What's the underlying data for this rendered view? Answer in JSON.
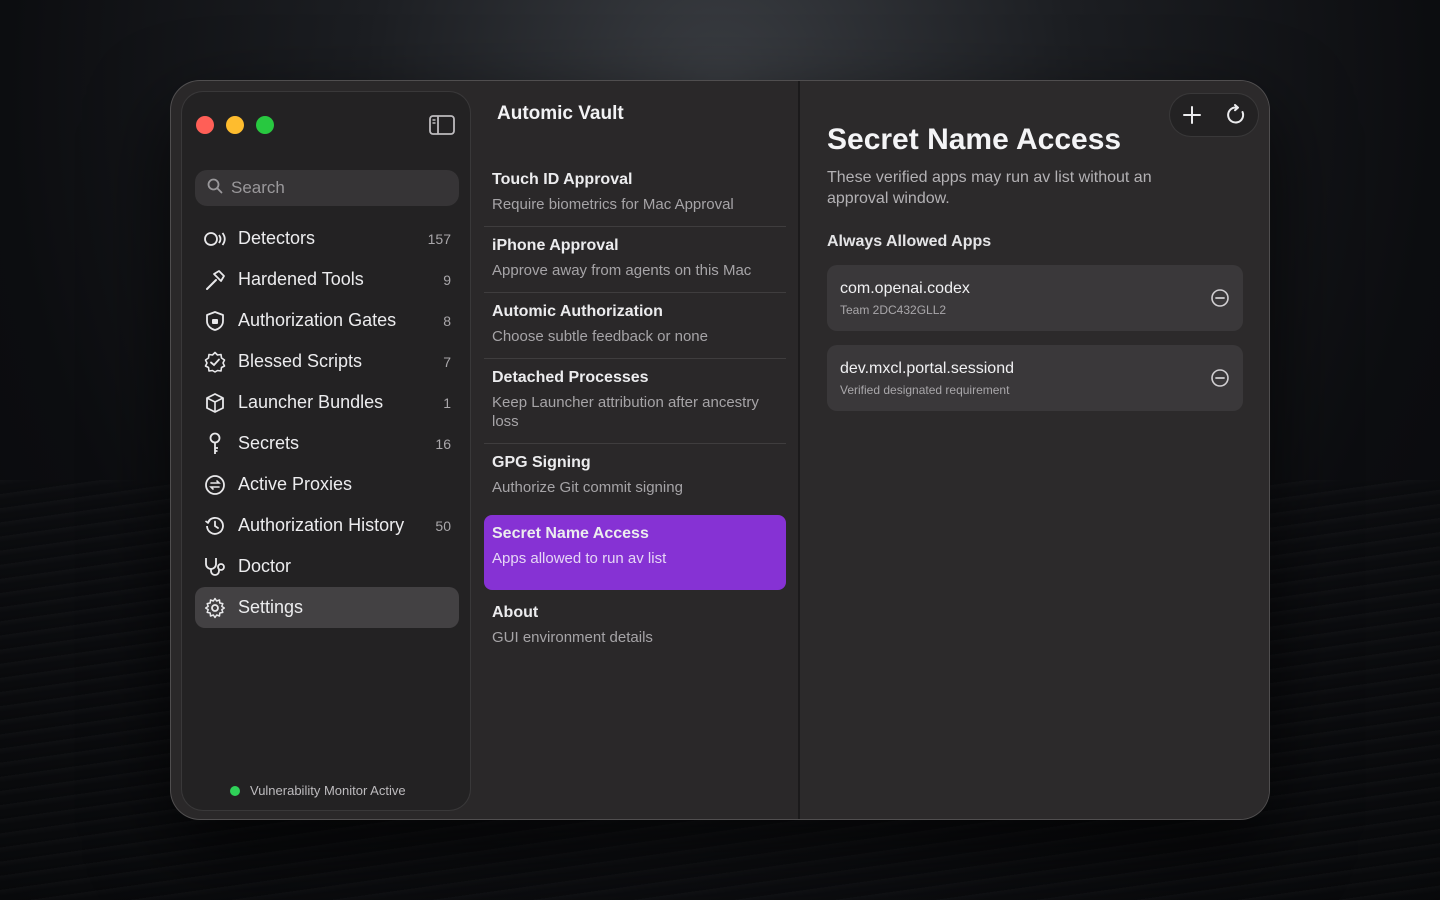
{
  "window": {
    "controls": {
      "close": "close",
      "minimize": "minimize",
      "zoom": "zoom"
    }
  },
  "sidebar": {
    "search": {
      "placeholder": "Search",
      "value": ""
    },
    "items": [
      {
        "label": "Detectors",
        "count": "157",
        "icon": "detector-icon"
      },
      {
        "label": "Hardened Tools",
        "count": "9",
        "icon": "hammer-icon"
      },
      {
        "label": "Authorization Gates",
        "count": "8",
        "icon": "shield-icon"
      },
      {
        "label": "Blessed Scripts",
        "count": "7",
        "icon": "checkmark-seal-icon"
      },
      {
        "label": "Launcher Bundles",
        "count": "1",
        "icon": "cube-icon"
      },
      {
        "label": "Secrets",
        "count": "16",
        "icon": "key-icon"
      },
      {
        "label": "Active Proxies",
        "count": "",
        "icon": "proxy-icon"
      },
      {
        "label": "Authorization History",
        "count": "50",
        "icon": "history-icon"
      },
      {
        "label": "Doctor",
        "count": "",
        "icon": "stethoscope-icon"
      },
      {
        "label": "Settings",
        "count": "",
        "icon": "gear-icon",
        "active": true
      }
    ],
    "status": "Vulnerability Monitor Active"
  },
  "middle": {
    "title": "Automic Vault",
    "rows": [
      {
        "title": "Touch ID Approval",
        "subtitle": "Require biometrics for Mac Approval"
      },
      {
        "title": "iPhone Approval",
        "subtitle": "Approve away from agents on this Mac"
      },
      {
        "title": "Automic Authorization",
        "subtitle": "Choose subtle feedback or none"
      },
      {
        "title": "Detached Processes",
        "subtitle": "Keep Launcher attribution after ancestry loss"
      },
      {
        "title": "GPG Signing",
        "subtitle": "Authorize Git commit signing"
      },
      {
        "title": "Secret Name Access",
        "subtitle": "Apps allowed to run av list",
        "active": true
      },
      {
        "title": "About",
        "subtitle": "GUI environment details"
      }
    ]
  },
  "detail": {
    "title": "Secret Name Access",
    "description": "These verified apps may run av list without an approval window.",
    "section": "Always Allowed Apps",
    "apps": [
      {
        "name": "com.openai.codex",
        "sub": "Team 2DC432GLL2"
      },
      {
        "name": "dev.mxcl.portal.sessiond",
        "sub": "Verified designated requirement"
      }
    ]
  },
  "colors": {
    "accent": "#8632d4",
    "status_green": "#2fd158",
    "traffic_red": "#ff5f57",
    "traffic_yellow": "#febc2e",
    "traffic_green": "#28c840"
  }
}
